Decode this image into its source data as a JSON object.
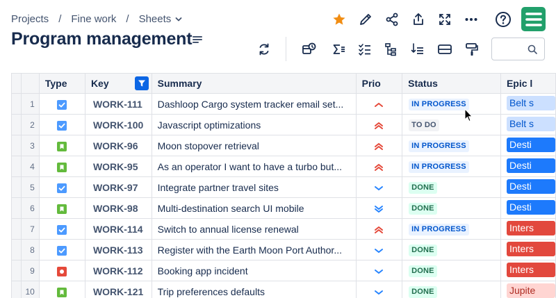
{
  "breadcrumb": {
    "items": [
      "Projects",
      "Fine work",
      "Sheets"
    ],
    "separator": "/"
  },
  "page": {
    "title": "Program management"
  },
  "colors": {
    "accent": "#0c66e4",
    "star": "#f18d13",
    "logo": "#22a06b"
  },
  "top_icons": [
    "star-icon",
    "edit-icon",
    "share-icon",
    "export-icon",
    "fullscreen-icon",
    "more-icon",
    "help-icon"
  ],
  "toolbar_icons": [
    "refresh-icon",
    "sync-schedule-icon",
    "sum-icon",
    "checklist-icon",
    "hierarchy-icon",
    "filter-list-icon",
    "row-height-icon",
    "paint-format-icon"
  ],
  "search": {
    "placeholder": "",
    "value": ""
  },
  "columns": {
    "type": "Type",
    "key": "Key",
    "summary": "Summary",
    "prio": "Prio",
    "status": "Status",
    "epic": "Epic l"
  },
  "rows": [
    {
      "num": "1",
      "type": "task",
      "key": "WORK-111",
      "summary": "Dashloop Cargo system tracker email set...",
      "prio": "medium-high",
      "status": "IN PROGRESS",
      "status_kind": "inprogress",
      "epic": "Belt s",
      "epic_color": "light"
    },
    {
      "num": "2",
      "type": "task",
      "key": "WORK-100",
      "summary": "Javascript optimizations",
      "prio": "high",
      "status": "TO DO",
      "status_kind": "todo",
      "epic": "Belt s",
      "epic_color": "light"
    },
    {
      "num": "3",
      "type": "story",
      "key": "WORK-96",
      "summary": "Moon stopover retrieval",
      "prio": "high",
      "status": "IN PROGRESS",
      "status_kind": "inprogress",
      "epic": "Desti",
      "epic_color": "blue"
    },
    {
      "num": "4",
      "type": "story",
      "key": "WORK-95",
      "summary": "As an operator I want to have a turbo but...",
      "prio": "high",
      "status": "IN PROGRESS",
      "status_kind": "inprogress",
      "epic": "Desti",
      "epic_color": "blue"
    },
    {
      "num": "5",
      "type": "task",
      "key": "WORK-97",
      "summary": "Integrate partner travel sites",
      "prio": "low",
      "status": "DONE",
      "status_kind": "done",
      "epic": "Desti",
      "epic_color": "blue"
    },
    {
      "num": "6",
      "type": "story",
      "key": "WORK-98",
      "summary": "Multi-destination search UI mobile",
      "prio": "lowest",
      "status": "DONE",
      "status_kind": "done",
      "epic": "Desti",
      "epic_color": "blue"
    },
    {
      "num": "7",
      "type": "task",
      "key": "WORK-114",
      "summary": "Switch to annual license renewal",
      "prio": "high",
      "status": "IN PROGRESS",
      "status_kind": "inprogress",
      "epic": "Inters",
      "epic_color": "red"
    },
    {
      "num": "8",
      "type": "task",
      "key": "WORK-113",
      "summary": "Register with the Earth Moon Port Author...",
      "prio": "low",
      "status": "DONE",
      "status_kind": "done",
      "epic": "Inters",
      "epic_color": "red"
    },
    {
      "num": "9",
      "type": "bug",
      "key": "WORK-112",
      "summary": "Booking app incident",
      "prio": "low",
      "status": "DONE",
      "status_kind": "done",
      "epic": "Inters",
      "epic_color": "red"
    },
    {
      "num": "10",
      "type": "story",
      "key": "WORK-121",
      "summary": "Trip preferences defaults",
      "prio": "low",
      "status": "DONE",
      "status_kind": "done",
      "epic": "Jupite",
      "epic_color": "pink"
    }
  ]
}
